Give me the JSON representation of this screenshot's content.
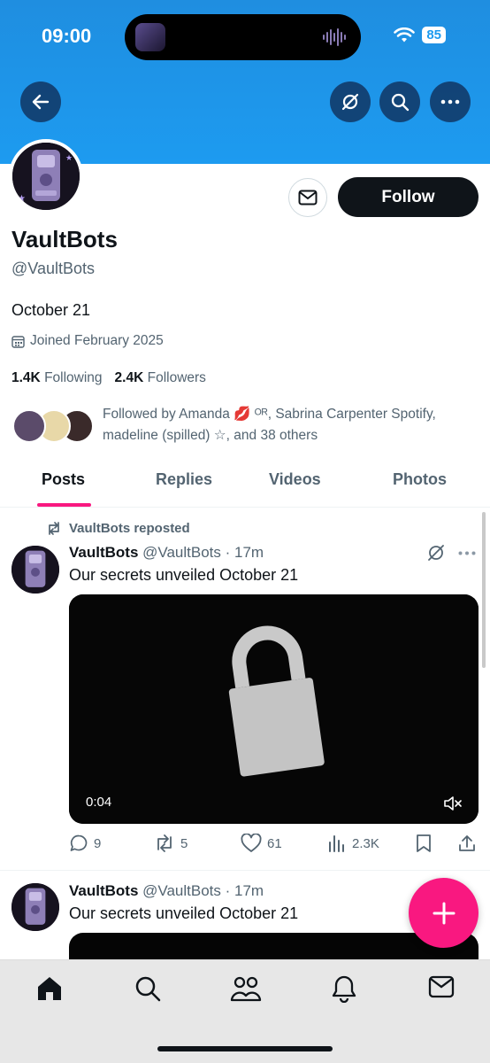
{
  "status_bar": {
    "time": "09:00",
    "battery": "85"
  },
  "profile": {
    "name": "VaultBots",
    "handle": "@VaultBots",
    "bio": "October 21",
    "joined": "Joined February 2025",
    "following_count": "1.4K",
    "following_label": "Following",
    "followers_count": "2.4K",
    "followers_label": "Followers",
    "followed_by": "Followed by Amanda 💋 ᴼᴿ, Sabrina Carpenter Spotify, madeline (spilled) ☆, and 38 others",
    "follow_label": "Follow"
  },
  "tabs": [
    {
      "label": "Posts"
    },
    {
      "label": "Replies"
    },
    {
      "label": "Videos"
    },
    {
      "label": "Photos"
    }
  ],
  "posts": [
    {
      "repost_label": "VaultBots reposted",
      "author": "VaultBots",
      "meta": "@VaultBots · 17m",
      "text": "Our secrets unveiled October 21",
      "media_time": "0:04",
      "replies": "9",
      "reposts": "5",
      "likes": "61",
      "views": "2.3K"
    },
    {
      "author": "VaultBots",
      "meta": "@VaultBots · 17m",
      "text": "Our secrets unveiled October 21"
    }
  ],
  "colors": {
    "banner": "#1d9bf0",
    "accent": "#f91880",
    "follow_button": "#0f1419"
  },
  "icons": [
    "back-arrow-icon",
    "grok-icon",
    "search-icon",
    "more-icon",
    "mail-icon",
    "calendar-icon",
    "repost-icon",
    "reply-icon",
    "like-icon",
    "views-icon",
    "bookmark-icon",
    "share-icon",
    "mute-icon",
    "plus-icon",
    "home-icon",
    "communities-icon",
    "bell-icon"
  ]
}
